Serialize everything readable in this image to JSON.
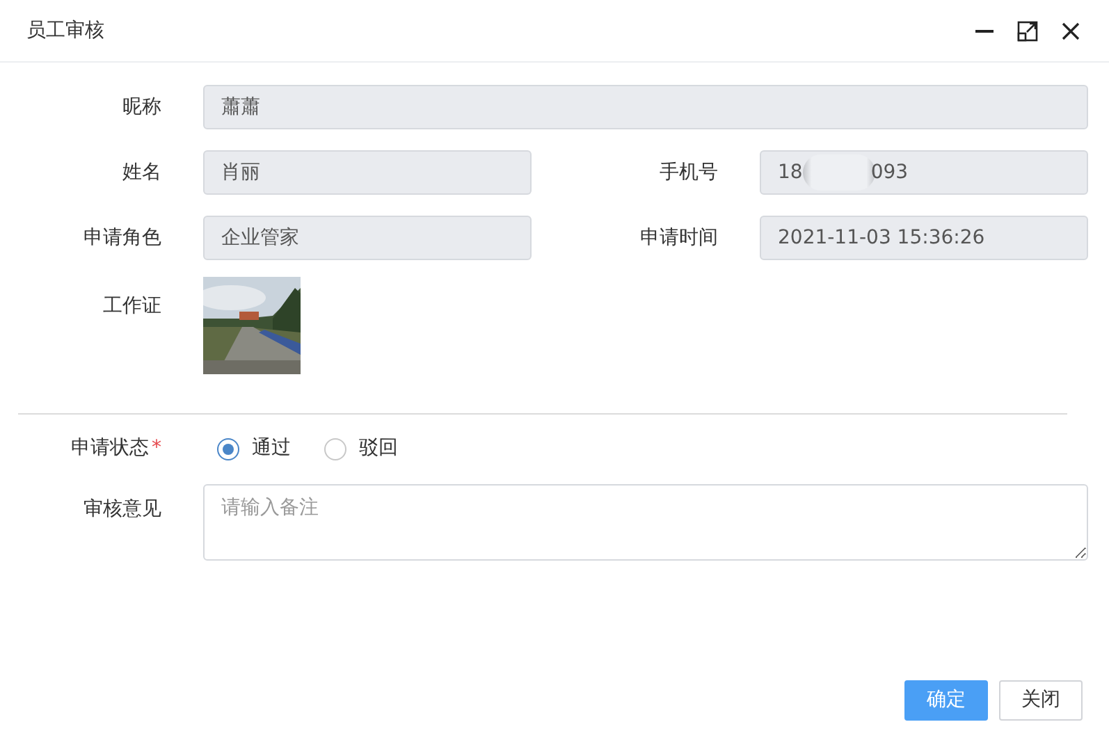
{
  "window": {
    "title": "员工审核"
  },
  "fields": [
    {
      "label": "昵称",
      "value": "蕭蕭",
      "kind": "full"
    },
    {
      "label": "姓名",
      "value": "肖丽",
      "kind": "half"
    },
    {
      "label": "手机号",
      "value_start": "18",
      "value_end": "093",
      "kind": "redacted"
    },
    {
      "label": "申请角色",
      "value": "企业管家",
      "kind": "half"
    },
    {
      "label": "申请时间",
      "value": "2021-11-03 15:36:26",
      "kind": "half"
    },
    {
      "label": "工作证",
      "kind": "picture"
    }
  ],
  "status": {
    "label": "申请状态",
    "required_mark": "*",
    "options": [
      {
        "label": "通过",
        "selected": true
      },
      {
        "label": "驳回",
        "selected": false
      }
    ]
  },
  "remark": {
    "label": "审核意见",
    "placeholder": "请输入备注"
  },
  "buttons": [
    {
      "label": "确定",
      "kind": "primary"
    },
    {
      "label": "关闭",
      "kind": "secondary"
    }
  ]
}
